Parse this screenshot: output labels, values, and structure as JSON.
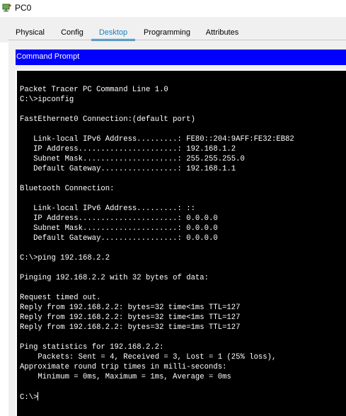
{
  "window": {
    "title": "PC0",
    "icon": "pc-app-icon"
  },
  "tabs": [
    {
      "label": "Physical",
      "active": false
    },
    {
      "label": "Config",
      "active": false
    },
    {
      "label": "Desktop",
      "active": true
    },
    {
      "label": "Programming",
      "active": false
    },
    {
      "label": "Attributes",
      "active": false
    }
  ],
  "panel": {
    "title": "Command Prompt",
    "header_color": "#0000ff"
  },
  "terminal": {
    "lines": [
      "Packet Tracer PC Command Line 1.0",
      "C:\\>ipconfig",
      "",
      "FastEthernet0 Connection:(default port)",
      "",
      "   Link-local IPv6 Address.........: FE80::204:9AFF:FE32:EB82",
      "   IP Address......................: 192.168.1.2",
      "   Subnet Mask.....................: 255.255.255.0",
      "   Default Gateway.................: 192.168.1.1",
      "",
      "Bluetooth Connection:",
      "",
      "   Link-local IPv6 Address.........: ::",
      "   IP Address......................: 0.0.0.0",
      "   Subnet Mask.....................: 0.0.0.0",
      "   Default Gateway.................: 0.0.0.0",
      "",
      "C:\\>ping 192.168.2.2",
      "",
      "Pinging 192.168.2.2 with 32 bytes of data:",
      "",
      "Request timed out.",
      "Reply from 192.168.2.2: bytes=32 time<1ms TTL=127",
      "Reply from 192.168.2.2: bytes=32 time<1ms TTL=127",
      "Reply from 192.168.2.2: bytes=32 time=1ms TTL=127",
      "",
      "Ping statistics for 192.168.2.2:",
      "    Packets: Sent = 4, Received = 3, Lost = 1 (25% loss),",
      "Approximate round trip times in milli-seconds:",
      "    Minimum = 0ms, Maximum = 1ms, Average = 0ms",
      "",
      "C:\\>"
    ]
  },
  "colors": {
    "accent": "#1a7fbf",
    "terminal_bg": "#000000",
    "terminal_fg": "#ffffff"
  }
}
